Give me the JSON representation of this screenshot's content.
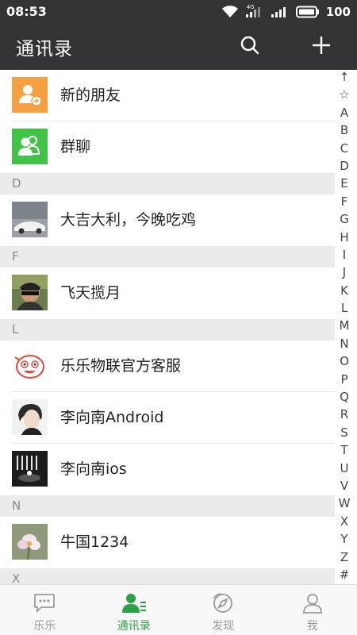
{
  "status_bar": {
    "time": "08:53",
    "network_type": "4G",
    "battery_level": "100"
  },
  "header": {
    "title": "通讯录",
    "icons": [
      "search-icon",
      "plus-icon"
    ]
  },
  "colors": {
    "header_bg": "#323335",
    "accent_green": "#2aa146",
    "new_friends_orange": "#f5a041",
    "group_chat_green": "#41c346",
    "section_bg": "#ebebeb"
  },
  "contacts": {
    "top_items": [
      {
        "label": "新的朋友",
        "icon": "new-friend-icon"
      },
      {
        "label": "群聊",
        "icon": "group-chat-icon"
      }
    ],
    "sections": [
      {
        "letter": "D",
        "items": [
          "大吉大利，今晚吃鸡"
        ]
      },
      {
        "letter": "F",
        "items": [
          "飞天揽月"
        ]
      },
      {
        "letter": "L",
        "items": [
          "乐乐物联官方客服",
          "李向南Android",
          "李向南ios"
        ]
      },
      {
        "letter": "N",
        "items": [
          "牛国1234"
        ]
      },
      {
        "letter": "X",
        "items": []
      }
    ]
  },
  "index_bar": [
    "↑",
    "☆",
    "A",
    "B",
    "C",
    "D",
    "E",
    "F",
    "G",
    "H",
    "I",
    "J",
    "K",
    "L",
    "M",
    "N",
    "O",
    "P",
    "Q",
    "R",
    "S",
    "T",
    "U",
    "V",
    "W",
    "X",
    "Y",
    "Z",
    "#"
  ],
  "tabs": [
    {
      "label": "乐乐",
      "icon": "chat-icon",
      "active": false
    },
    {
      "label": "通讯录",
      "icon": "contacts-icon",
      "active": true
    },
    {
      "label": "发现",
      "icon": "compass-icon",
      "active": false
    },
    {
      "label": "我",
      "icon": "person-icon",
      "active": false
    }
  ]
}
